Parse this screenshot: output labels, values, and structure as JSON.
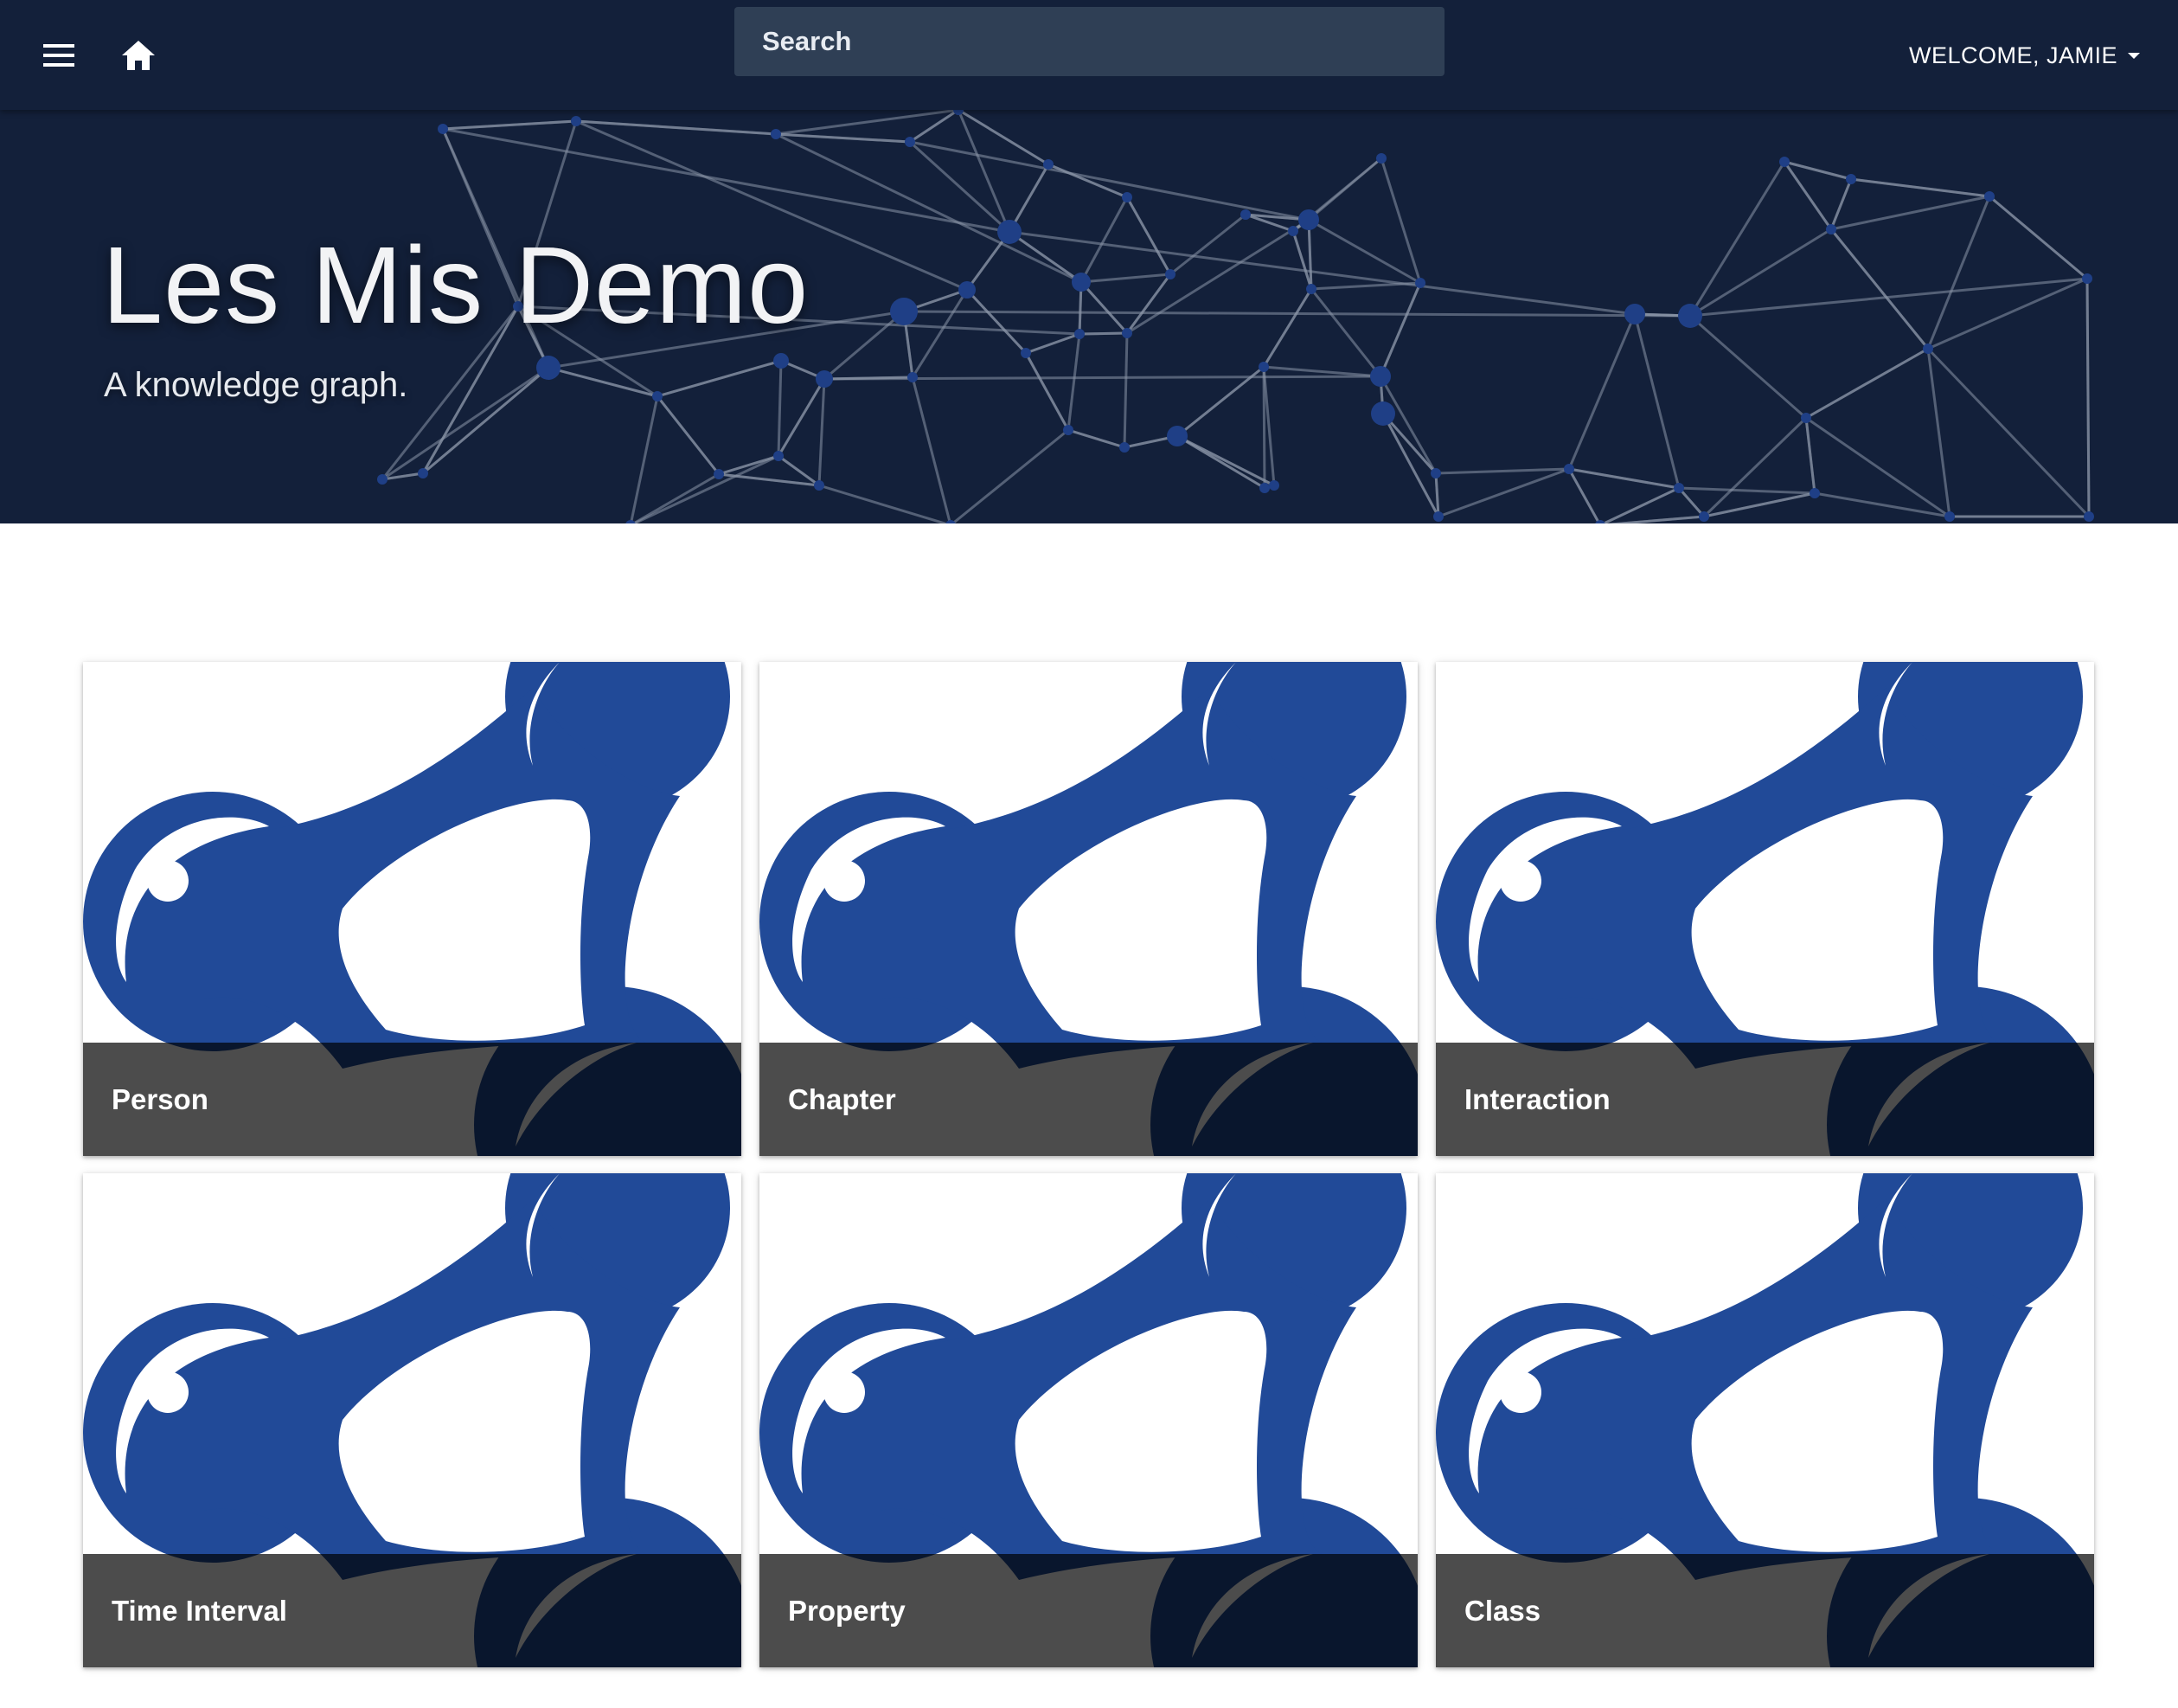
{
  "colors": {
    "appbar": "#13203a",
    "hero": "#13203a",
    "search_bg": "#2f3f55",
    "logo_blue": "#214a98",
    "card_footer": "rgba(0,0,0,0.70)"
  },
  "topbar": {
    "menu_icon": "hamburger-menu-icon",
    "home_icon": "home-icon",
    "search_placeholder": "Search",
    "user_greeting": "WELCOME, JAMIE",
    "user_dropdown_icon": "caret-down-icon"
  },
  "hero": {
    "title": "Les Mis Demo",
    "subtitle": "A knowledge graph.",
    "background_icon": "network-graph-background"
  },
  "cards": [
    {
      "label": "Person",
      "image_icon": "rdf-logo-icon"
    },
    {
      "label": "Chapter",
      "image_icon": "rdf-logo-icon"
    },
    {
      "label": "Interaction",
      "image_icon": "rdf-logo-icon"
    },
    {
      "label": "Time Interval",
      "image_icon": "rdf-logo-icon"
    },
    {
      "label": "Property",
      "image_icon": "rdf-logo-icon"
    },
    {
      "label": "Class",
      "image_icon": "rdf-logo-icon"
    }
  ]
}
